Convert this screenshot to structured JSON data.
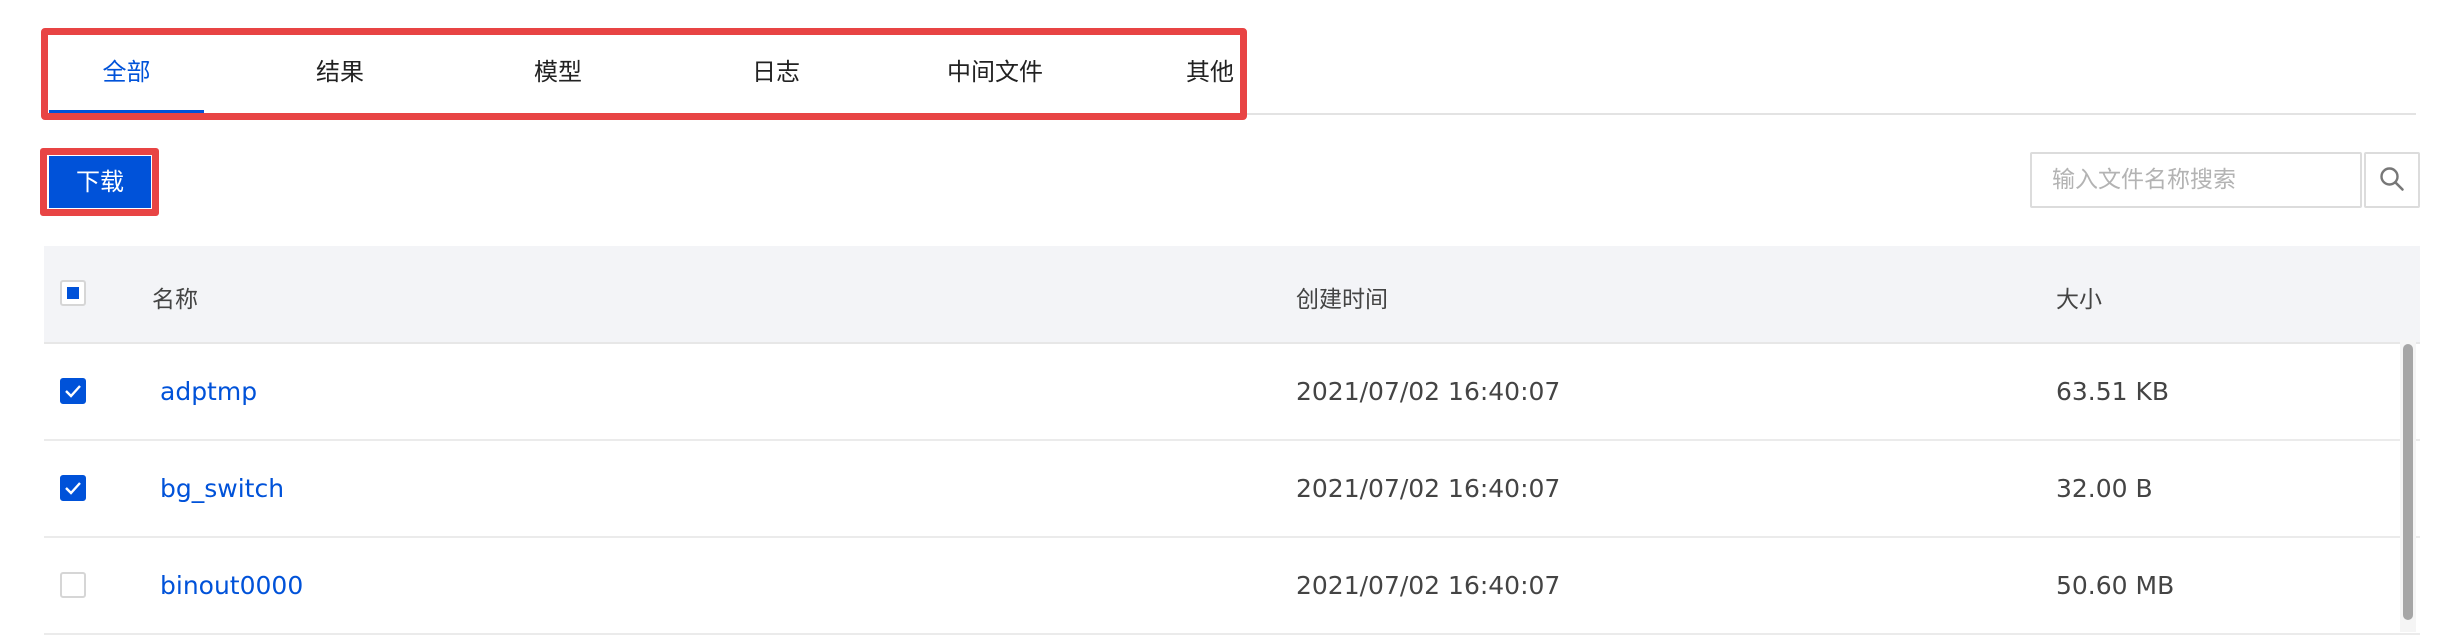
{
  "tabs": [
    {
      "label": "全部",
      "active": true
    },
    {
      "label": "结果",
      "active": false
    },
    {
      "label": "模型",
      "active": false
    },
    {
      "label": "日志",
      "active": false
    },
    {
      "label": "中间文件",
      "active": false
    },
    {
      "label": "其他",
      "active": false
    }
  ],
  "toolbar": {
    "download_label": "下载",
    "search_placeholder": "输入文件名称搜索",
    "search_icon": "search-icon"
  },
  "table": {
    "select_all_state": "partial",
    "columns": {
      "name": "名称",
      "created": "创建时间",
      "size": "大小"
    },
    "rows": [
      {
        "checked": true,
        "name": "adptmp",
        "created": "2021/07/02 16:40:07",
        "size": "63.51 KB"
      },
      {
        "checked": true,
        "name": "bg_switch",
        "created": "2021/07/02 16:40:07",
        "size": "32.00 B"
      },
      {
        "checked": false,
        "name": "binout0000",
        "created": "2021/07/02 16:40:07",
        "size": "50.60 MB"
      }
    ]
  },
  "colors": {
    "accent": "#0052d9",
    "highlight": "#e84444"
  }
}
